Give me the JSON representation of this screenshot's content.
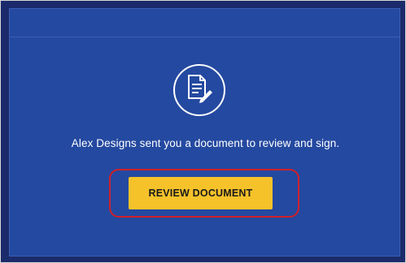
{
  "email": {
    "message": "Alex Designs sent you a document to review and sign.",
    "button_label": "REVIEW DOCUMENT",
    "icon": "document-sign-icon"
  },
  "colors": {
    "panel": "#2449a0",
    "frame": "#1b2a6b",
    "button": "#f5c22a",
    "highlight": "#d0202a"
  }
}
